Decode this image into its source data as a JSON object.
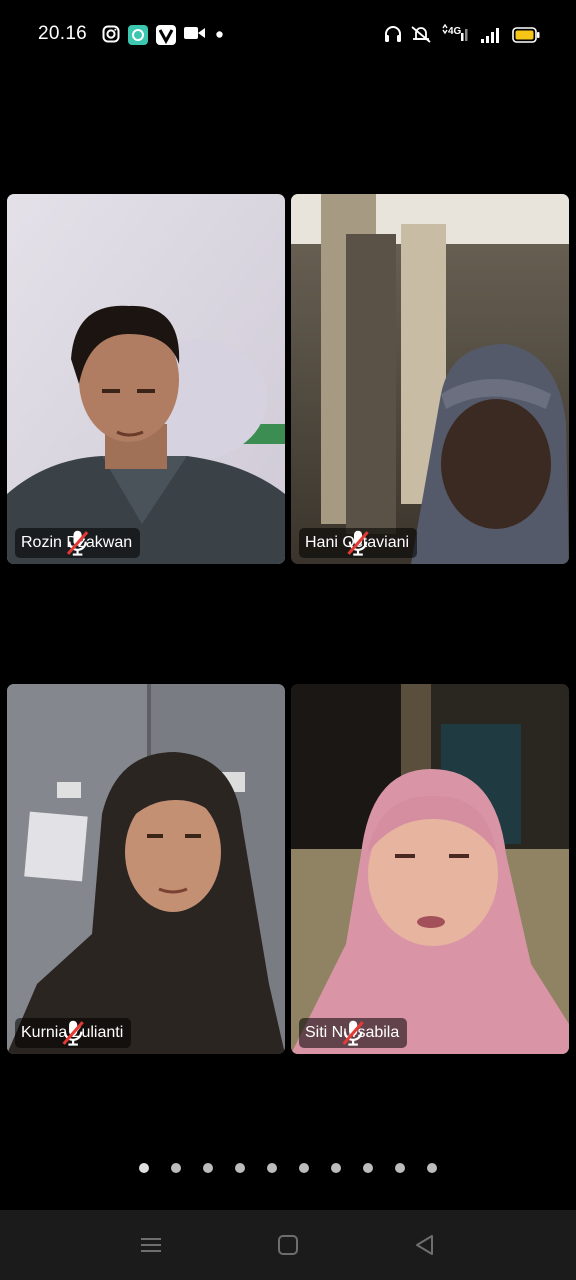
{
  "status_bar": {
    "time": "20.16",
    "left_icons": [
      "instagram-icon",
      "chat-bubble-icon",
      "v-app-icon",
      "video-camera-icon",
      "notification-dot-icon"
    ],
    "right_icons": [
      "headphones-icon",
      "silent-bell-icon",
      "4g-signal-icon",
      "cell-signal-icon",
      "battery-icon"
    ],
    "network_label": "4G"
  },
  "participants": [
    {
      "name": "Rozin Dzakwan",
      "mic": "muted"
    },
    {
      "name": "Hani Octaviani",
      "mic": "muted"
    },
    {
      "name": "Kurnia Zulianti",
      "mic": "muted"
    },
    {
      "name": "Siti Nursabila",
      "mic": "muted"
    }
  ],
  "pagination": {
    "page_count": 10,
    "current_page": 1
  },
  "nav_bar": {
    "buttons": [
      "menu-button",
      "home-button",
      "back-button"
    ]
  },
  "colors": {
    "battery": "#f5c518",
    "app_badge_teal": "#3cc7b0",
    "nav_bg": "#1b1b1b",
    "dot": "#bdbdbd"
  }
}
